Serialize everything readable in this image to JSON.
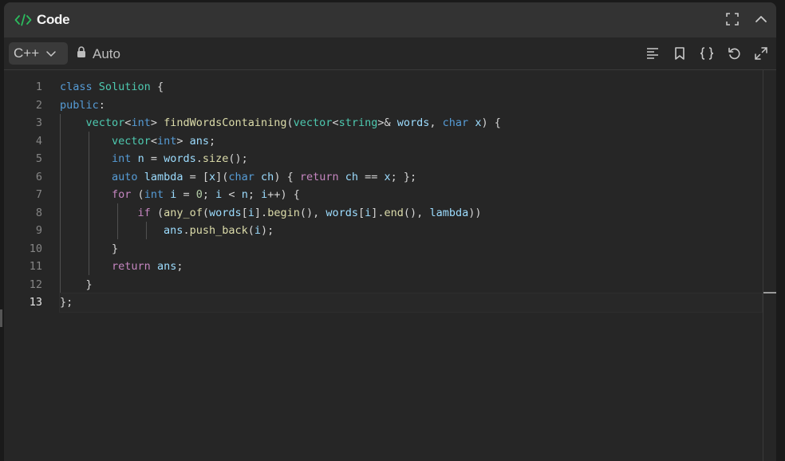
{
  "header": {
    "title": "Code",
    "accent": "#2cbb5d"
  },
  "toolbar": {
    "language": "C++",
    "mode_label": "Auto",
    "tools": [
      "format-icon",
      "bookmark-icon",
      "braces-icon",
      "reset-icon",
      "expand-icon"
    ]
  },
  "editor": {
    "line_numbers": [
      "1",
      "2",
      "3",
      "4",
      "5",
      "6",
      "7",
      "8",
      "9",
      "10",
      "11",
      "12",
      "13"
    ],
    "current_line": 13
  }
}
